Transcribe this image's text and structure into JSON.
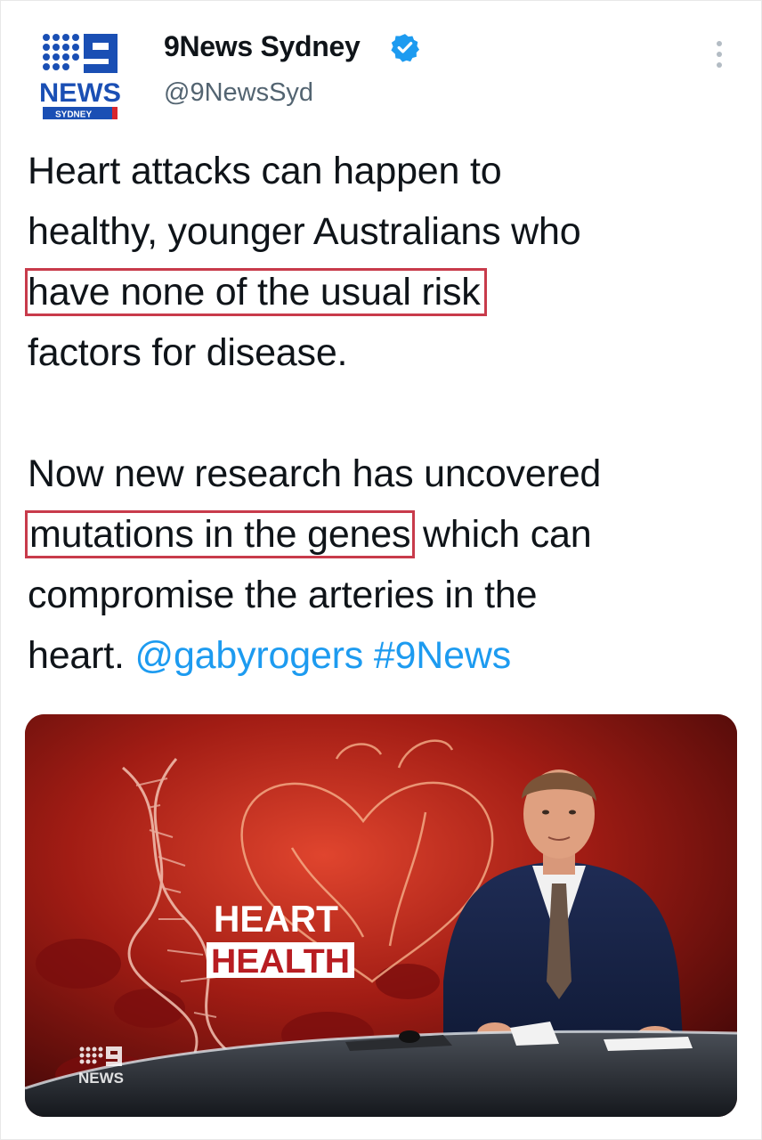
{
  "account": {
    "name": "9News Sydney",
    "handle": "@9NewsSyd",
    "verified": true,
    "logo": {
      "top_text": "NEWS",
      "sub_text": "SYDNEY",
      "brand_color": "#1a4fb4",
      "icon": "nine-news-logo"
    }
  },
  "tweet": {
    "paragraph1_lines": [
      "Heart attacks can happen to",
      "healthy, younger Australians who",
      "have none of the usual risk",
      "factors for disease."
    ],
    "paragraph2_lines": [
      "Now new research has uncovered",
      "mutations in the genes",
      " which can",
      "compromise the arteries in the",
      "heart. "
    ],
    "mention": "@gabyrogers",
    "hashtag": "#9News"
  },
  "media": {
    "graphic_title_line1": "HEART",
    "graphic_title_line2": "HEALTH",
    "watermark": "NEWS",
    "alt": "Presenter in news studio with heart health graphic"
  },
  "colors": {
    "text": "#0f1419",
    "secondary": "#536471",
    "link": "#1d9bf0",
    "highlight_box": "#c83b4b",
    "verified": "#1d9bf0"
  }
}
